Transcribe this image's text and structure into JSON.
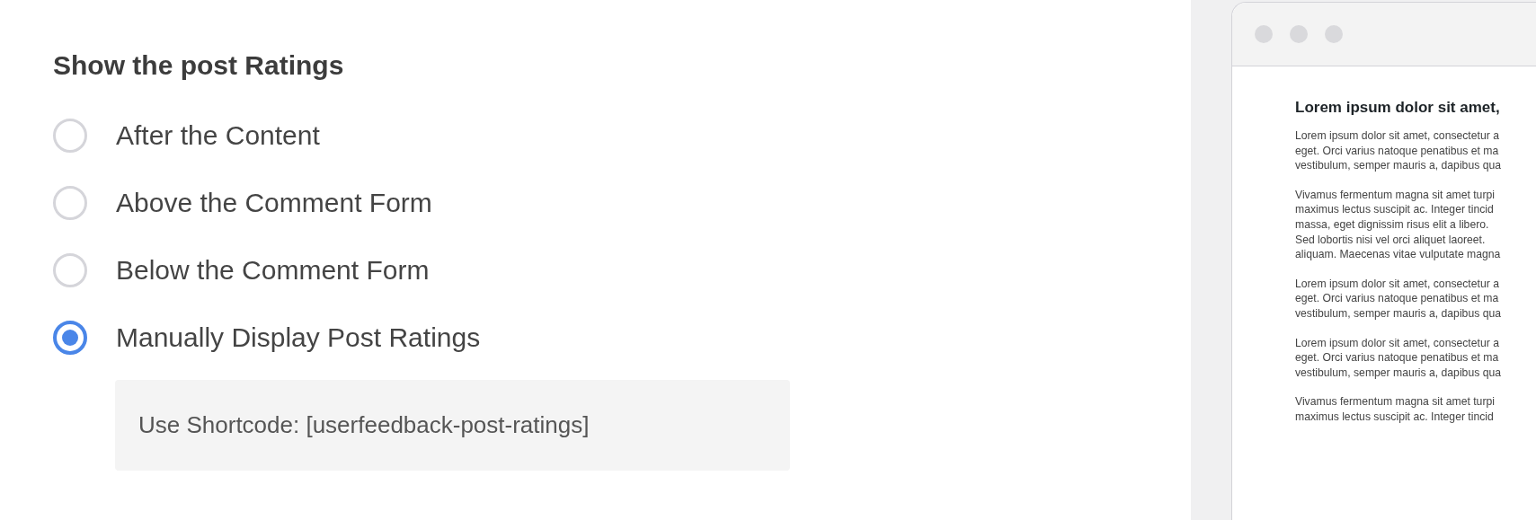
{
  "settings": {
    "heading": "Show the post Ratings",
    "options": [
      {
        "label": "After the Content",
        "selected": false
      },
      {
        "label": "Above the Comment Form",
        "selected": false
      },
      {
        "label": "Below the Comment Form",
        "selected": false
      },
      {
        "label": "Manually Display Post Ratings",
        "selected": true
      }
    ],
    "shortcode_note": "Use Shortcode: [userfeedback-post-ratings]"
  },
  "preview": {
    "heading": "Lorem ipsum dolor sit amet,",
    "paragraphs": [
      {
        "lines": [
          "Lorem ipsum dolor sit amet, consectetur a",
          "eget. Orci varius natoque penatibus et ma",
          "vestibulum, semper mauris a, dapibus qua"
        ]
      },
      {
        "lines": [
          "Vivamus fermentum magna sit amet turpi",
          "maximus lectus suscipit ac. Integer tincid",
          "massa, eget dignissim risus elit a libero.",
          "Sed lobortis nisi vel orci aliquet laoreet.",
          "aliquam. Maecenas vitae vulputate magna"
        ]
      },
      {
        "lines": [
          "Lorem ipsum dolor sit amet, consectetur a",
          "eget. Orci varius natoque penatibus et ma",
          "vestibulum, semper mauris a, dapibus qua"
        ]
      },
      {
        "lines": [
          "Lorem ipsum dolor sit amet, consectetur a",
          "eget. Orci varius natoque penatibus et ma",
          "vestibulum, semper mauris a, dapibus qua"
        ]
      },
      {
        "lines": [
          "Vivamus fermentum magna sit amet turpi",
          "maximus lectus suscipit ac. Integer tincid"
        ]
      }
    ]
  }
}
